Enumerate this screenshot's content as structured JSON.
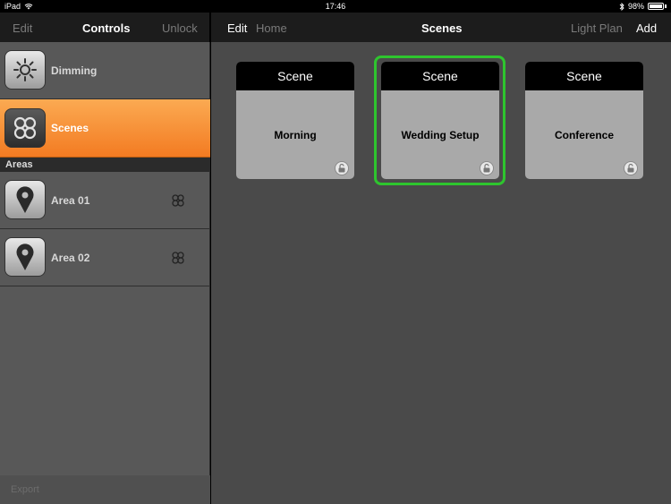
{
  "status": {
    "device": "iPad",
    "time": "17:46",
    "battery": "98%"
  },
  "left_nav": {
    "edit": "Edit",
    "title": "Controls",
    "unlock": "Unlock"
  },
  "right_nav": {
    "edit": "Edit",
    "home": "Home",
    "title": "Scenes",
    "light_plan": "Light Plan",
    "add": "Add"
  },
  "sidebar": {
    "items": [
      {
        "label": "Dimming",
        "icon": "sun-icon"
      },
      {
        "label": "Scenes",
        "icon": "scenes-icon",
        "active": true
      }
    ],
    "areas_header": "Areas",
    "areas": [
      {
        "label": "Area 01",
        "icon": "map-pin-icon"
      },
      {
        "label": "Area 02",
        "icon": "map-pin-icon"
      }
    ],
    "export": "Export"
  },
  "scenes": [
    {
      "header": "Scene",
      "name": "Morning",
      "selected": false
    },
    {
      "header": "Scene",
      "name": "Wedding Setup",
      "selected": true
    },
    {
      "header": "Scene",
      "name": "Conference",
      "selected": false
    }
  ],
  "colors": {
    "accent_orange": "#f37b22",
    "selection_green": "#2ec52e",
    "card_gray": "#a9a9a9"
  }
}
